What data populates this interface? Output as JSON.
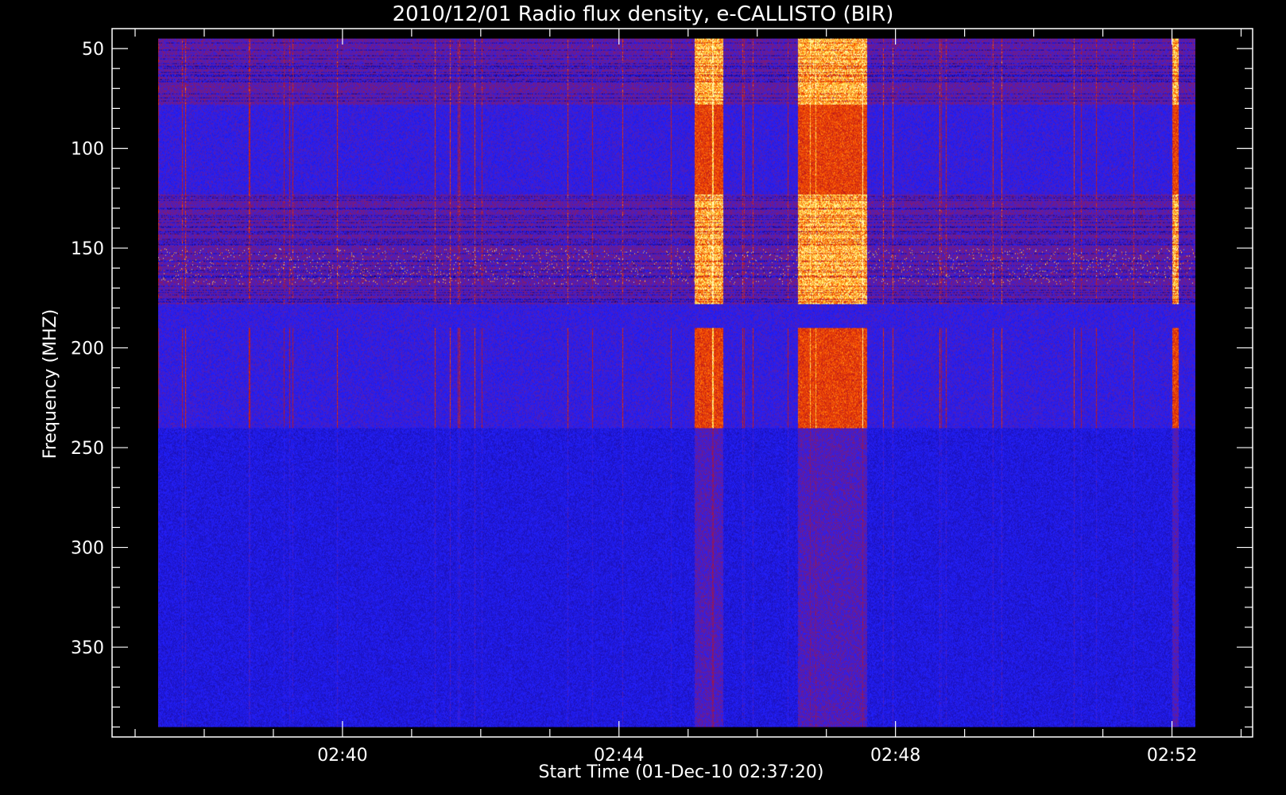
{
  "chart_data": {
    "type": "heatmap",
    "title": "2010/12/01  Radio flux density, e-CALLISTO (BIR)",
    "xlabel": "Start Time (01-Dec-10 02:37:20)",
    "ylabel": "Frequency (MHZ)",
    "y_axis_inverted": true,
    "xlim_minutes": [
      "02:36:40",
      "02:53:10"
    ],
    "data_time_range": [
      "02:37:20",
      "02:52:20"
    ],
    "ylim": [
      40,
      395
    ],
    "data_freq_range": [
      45,
      390
    ],
    "x_ticks": [
      {
        "label": "02:40",
        "minute": 160
      },
      {
        "label": "02:44",
        "minute": 164
      },
      {
        "label": "02:48",
        "minute": 168
      },
      {
        "label": "02:52",
        "minute": 172
      }
    ],
    "y_ticks": [
      50,
      100,
      150,
      200,
      250,
      300,
      350
    ],
    "colormap": [
      "#000000",
      "#1a0060",
      "#2020ff",
      "#c01818",
      "#ff5a00",
      "#ffe040",
      "#ffffc0"
    ],
    "burst_minutes": [
      {
        "start": "02:45:05",
        "end": "02:45:30"
      },
      {
        "start": "02:46:35",
        "end": "02:47:35"
      },
      {
        "start": "02:52:00",
        "end": "02:52:05"
      }
    ],
    "band_features_mhz": [
      {
        "from": 45,
        "to": 78,
        "level": "high"
      },
      {
        "from": 78,
        "to": 123,
        "level": "medium"
      },
      {
        "from": 123,
        "to": 178,
        "level": "high"
      },
      {
        "from": 178,
        "to": 182,
        "level": "medium"
      },
      {
        "from": 182,
        "to": 208,
        "level": "medium"
      },
      {
        "from": 208,
        "to": 240,
        "level": "medium"
      },
      {
        "from": 240,
        "to": 270,
        "level": "low"
      },
      {
        "from": 270,
        "to": 390,
        "level": "low"
      }
    ]
  }
}
